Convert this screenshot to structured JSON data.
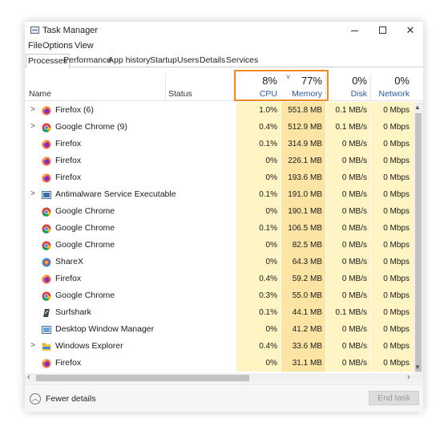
{
  "window": {
    "title": "Task Manager"
  },
  "menu": [
    "File",
    "Options",
    "View"
  ],
  "tabs": [
    "Processes",
    "Performance",
    "App history",
    "Startup",
    "Users",
    "Details",
    "Services"
  ],
  "active_tab": "Processes",
  "columns": {
    "name": "Name",
    "status": "Status",
    "cpu": {
      "percent": "8%",
      "label": "CPU"
    },
    "memory": {
      "percent": "77%",
      "label": "Memory",
      "sort_indicator": "˅"
    },
    "disk": {
      "percent": "0%",
      "label": "Disk"
    },
    "network": {
      "percent": "0%",
      "label": "Network"
    }
  },
  "processes": [
    {
      "name": "Firefox (6)",
      "icon": "firefox-icon",
      "expandable": true,
      "cpu": "1.0%",
      "memory": "551.8 MB",
      "disk": "0.1 MB/s",
      "network": "0 Mbps"
    },
    {
      "name": "Google Chrome (9)",
      "icon": "chrome-icon",
      "expandable": true,
      "cpu": "0.4%",
      "memory": "512.9 MB",
      "disk": "0.1 MB/s",
      "network": "0 Mbps"
    },
    {
      "name": "Firefox",
      "icon": "firefox-icon",
      "expandable": false,
      "cpu": "0.1%",
      "memory": "314.9 MB",
      "disk": "0 MB/s",
      "network": "0 Mbps"
    },
    {
      "name": "Firefox",
      "icon": "firefox-icon",
      "expandable": false,
      "cpu": "0%",
      "memory": "226.1 MB",
      "disk": "0 MB/s",
      "network": "0 Mbps"
    },
    {
      "name": "Firefox",
      "icon": "firefox-icon",
      "expandable": false,
      "cpu": "0%",
      "memory": "193.6 MB",
      "disk": "0 MB/s",
      "network": "0 Mbps"
    },
    {
      "name": "Antimalware Service Executable",
      "icon": "antimalware-icon",
      "expandable": true,
      "cpu": "0.1%",
      "memory": "191.0 MB",
      "disk": "0 MB/s",
      "network": "0 Mbps"
    },
    {
      "name": "Google Chrome",
      "icon": "chrome-icon",
      "expandable": false,
      "cpu": "0%",
      "memory": "190.1 MB",
      "disk": "0 MB/s",
      "network": "0 Mbps"
    },
    {
      "name": "Google Chrome",
      "icon": "chrome-icon",
      "expandable": false,
      "cpu": "0.1%",
      "memory": "106.5 MB",
      "disk": "0 MB/s",
      "network": "0 Mbps"
    },
    {
      "name": "Google Chrome",
      "icon": "chrome-icon",
      "expandable": false,
      "cpu": "0%",
      "memory": "82.5 MB",
      "disk": "0 MB/s",
      "network": "0 Mbps"
    },
    {
      "name": "ShareX",
      "icon": "sharex-icon",
      "expandable": false,
      "cpu": "0%",
      "memory": "64.3 MB",
      "disk": "0 MB/s",
      "network": "0 Mbps"
    },
    {
      "name": "Firefox",
      "icon": "firefox-icon",
      "expandable": false,
      "cpu": "0.4%",
      "memory": "59.2 MB",
      "disk": "0 MB/s",
      "network": "0 Mbps"
    },
    {
      "name": "Google Chrome",
      "icon": "chrome-icon",
      "expandable": false,
      "cpu": "0.3%",
      "memory": "55.0 MB",
      "disk": "0 MB/s",
      "network": "0 Mbps"
    },
    {
      "name": "Surfshark",
      "icon": "surfshark-icon",
      "expandable": false,
      "cpu": "0.1%",
      "memory": "44.1 MB",
      "disk": "0.1 MB/s",
      "network": "0 Mbps"
    },
    {
      "name": "Desktop Window Manager",
      "icon": "dwm-icon",
      "expandable": false,
      "cpu": "0%",
      "memory": "41.2 MB",
      "disk": "0 MB/s",
      "network": "0 Mbps"
    },
    {
      "name": "Windows Explorer",
      "icon": "explorer-icon",
      "expandable": true,
      "cpu": "0.4%",
      "memory": "33.6 MB",
      "disk": "0 MB/s",
      "network": "0 Mbps"
    },
    {
      "name": "Firefox",
      "icon": "firefox-icon",
      "expandable": false,
      "cpu": "0%",
      "memory": "31.1 MB",
      "disk": "0 MB/s",
      "network": "0 Mbps"
    }
  ],
  "footer": {
    "fewer_details": "Fewer details",
    "end_task": "End task"
  },
  "colors": {
    "highlight": "#f08a21",
    "cpu_cell": "#fff4c4",
    "memory_cell": "#fbe4a4",
    "header_label": "#2d5a9e"
  }
}
